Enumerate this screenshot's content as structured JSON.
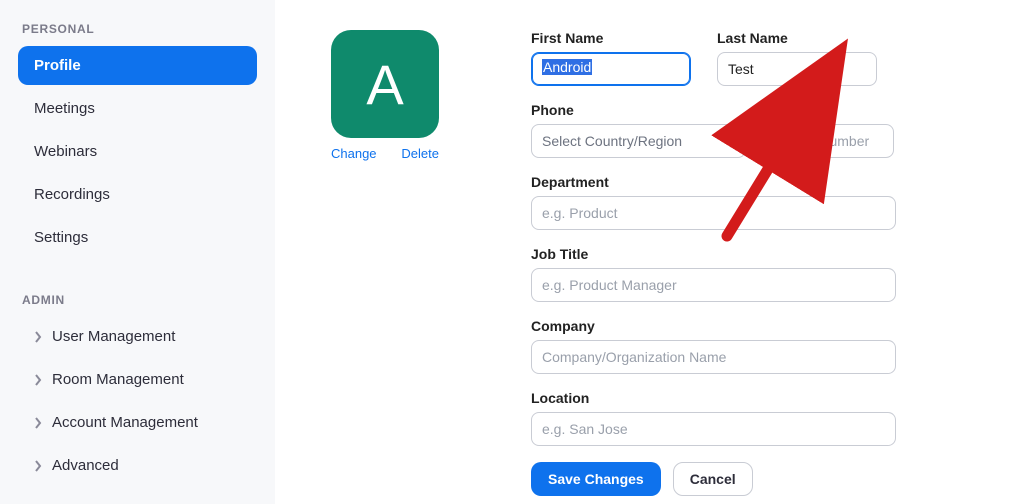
{
  "sidebar": {
    "personal_label": "PERSONAL",
    "admin_label": "ADMIN",
    "personal_items": [
      {
        "label": "Profile",
        "active": true
      },
      {
        "label": "Meetings"
      },
      {
        "label": "Webinars"
      },
      {
        "label": "Recordings"
      },
      {
        "label": "Settings"
      }
    ],
    "admin_items": [
      {
        "label": "User Management"
      },
      {
        "label": "Room Management"
      },
      {
        "label": "Account Management"
      },
      {
        "label": "Advanced"
      }
    ]
  },
  "avatar": {
    "initial": "A",
    "change_label": "Change",
    "delete_label": "Delete",
    "bg_color": "#0f8a6c"
  },
  "form": {
    "first_name": {
      "label": "First Name",
      "value": "Android"
    },
    "last_name": {
      "label": "Last Name",
      "value": "Test"
    },
    "phone": {
      "label": "Phone",
      "region_placeholder": "Select Country/Region",
      "number_placeholder": "Phone Number"
    },
    "department": {
      "label": "Department",
      "placeholder": "e.g. Product"
    },
    "job_title": {
      "label": "Job Title",
      "placeholder": "e.g. Product Manager"
    },
    "company": {
      "label": "Company",
      "placeholder": "Company/Organization Name"
    },
    "location": {
      "label": "Location",
      "placeholder": "e.g. San Jose"
    }
  },
  "actions": {
    "save": "Save Changes",
    "cancel": "Cancel"
  }
}
